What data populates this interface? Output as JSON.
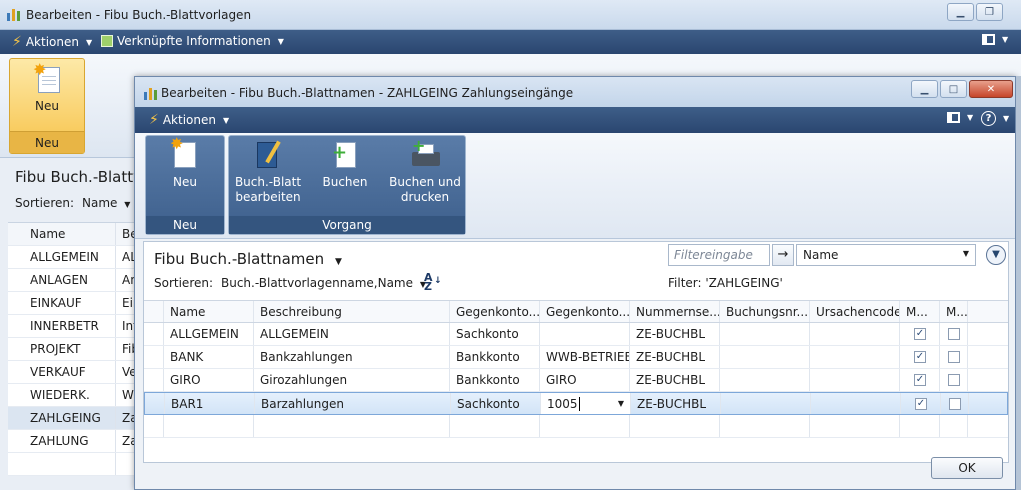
{
  "bg": {
    "title": "Bearbeiten - Fibu Buch.-Blattvorlagen",
    "actions_label": "Aktionen",
    "related_label": "Verknüpfte Informationen",
    "ribbon": {
      "new_label": "Neu",
      "group_label": "Neu"
    },
    "list_title": "Fibu Buch.-Blattvo",
    "sort_label": "Sortieren:",
    "sort_value": "Name",
    "columns": [
      "Name",
      "Be"
    ],
    "rows": [
      {
        "name": "ALLGEMEIN",
        "desc": "AL"
      },
      {
        "name": "ANLAGEN",
        "desc": "An"
      },
      {
        "name": "EINKAUF",
        "desc": "Ein"
      },
      {
        "name": "INNERBETR",
        "desc": "Int"
      },
      {
        "name": "PROJEKT",
        "desc": "Fib"
      },
      {
        "name": "VERKAUF",
        "desc": "Ve"
      },
      {
        "name": "WIEDERK.",
        "desc": "Wi"
      },
      {
        "name": "ZAHLGEING",
        "desc": "Zal"
      },
      {
        "name": "ZAHLUNG",
        "desc": "Za"
      }
    ]
  },
  "dlg": {
    "title": "Bearbeiten - Fibu Buch.-Blattnamen - ZAHLGEING Zahlungseingänge",
    "actions_label": "Aktionen",
    "ribbon": {
      "new_label": "Neu",
      "new_group": "Neu",
      "edit_label_1": "Buch.-Blatt",
      "edit_label_2": "bearbeiten",
      "post_label": "Buchen",
      "post_print_1": "Buchen und",
      "post_print_2": "drucken",
      "process_group": "Vorgang"
    },
    "list_title": "Fibu Buch.-Blattnamen",
    "filter_placeholder": "Filtereingabe",
    "filter_field": "Name",
    "sort_label": "Sortieren:",
    "sort_value": "Buch.-Blattvorlagenname,Name",
    "filter_text": "Filter: 'ZAHLGEING'",
    "columns": [
      "Name",
      "Beschreibung",
      "Gegenkonto...",
      "Gegenkonto...",
      "Nummernse...",
      "Buchungsnr....",
      "Ursachencode",
      "M...",
      "M..."
    ],
    "rows": [
      {
        "name": "ALLGEMEIN",
        "desc": "ALLGEMEIN",
        "acc_type": "Sachkonto",
        "acc_no": "",
        "series": "ZE-BUCHBL",
        "m1": true,
        "m2": false
      },
      {
        "name": "BANK",
        "desc": "Bankzahlungen",
        "acc_type": "Bankkonto",
        "acc_no": "WWB-BETRIEB",
        "series": "ZE-BUCHBL",
        "m1": true,
        "m2": false
      },
      {
        "name": "GIRO",
        "desc": "Girozahlungen",
        "acc_type": "Bankkonto",
        "acc_no": "GIRO",
        "series": "ZE-BUCHBL",
        "m1": true,
        "m2": false
      },
      {
        "name": "BAR1",
        "desc": "Barzahlungen",
        "acc_type": "Sachkonto",
        "acc_no": "1005",
        "series": "ZE-BUCHBL",
        "m1": true,
        "m2": false
      }
    ],
    "ok_label": "OK"
  }
}
